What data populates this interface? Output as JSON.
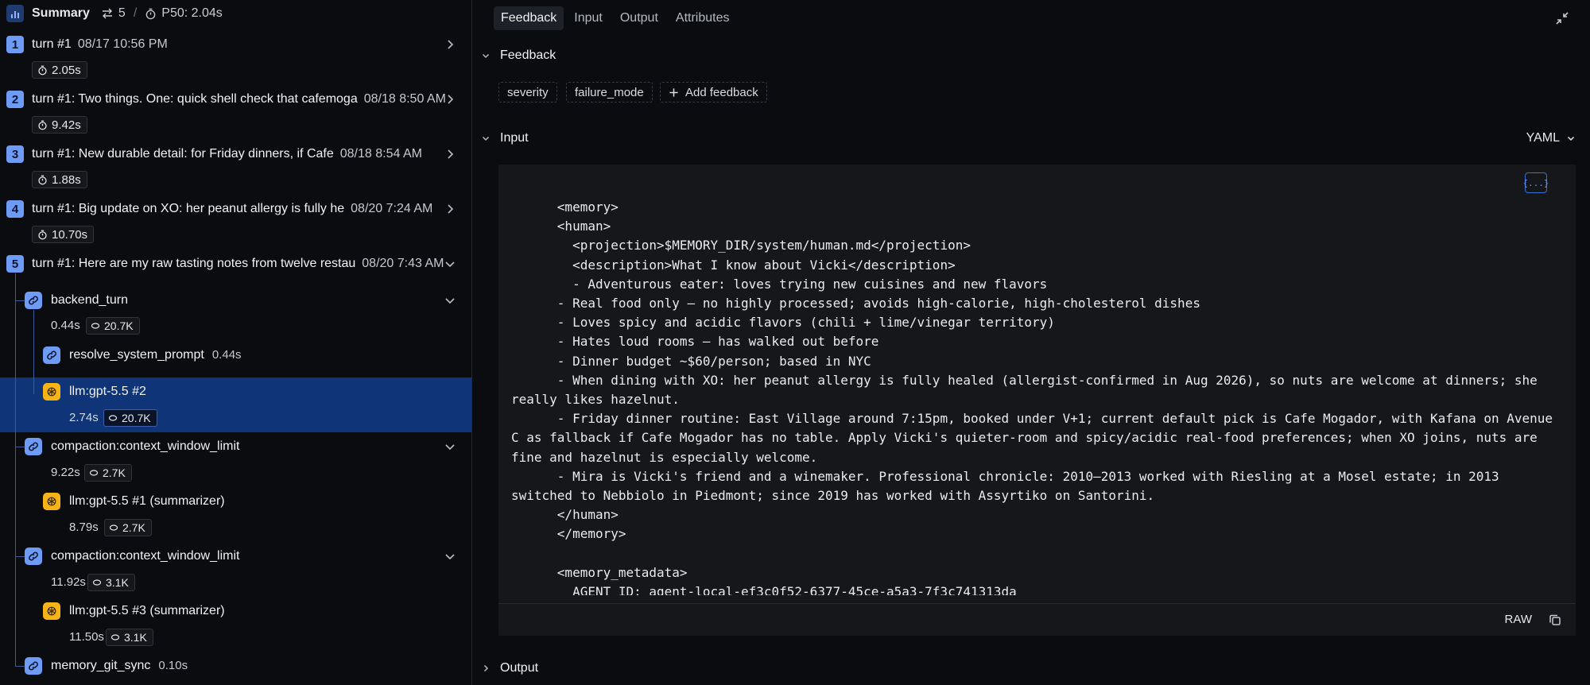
{
  "summary": {
    "title": "Summary",
    "turn_count": "5",
    "separator": "/",
    "p50": "P50: 2.04s"
  },
  "turns": [
    {
      "num": "1",
      "label": "turn #1",
      "date": "08/17 10:56 PM",
      "duration": "2.05s"
    },
    {
      "num": "2",
      "label": "turn #1: Two things. One: quick shell check that cafemoga",
      "date": "08/18 8:50 AM",
      "duration": "9.42s"
    },
    {
      "num": "3",
      "label": "turn #1: New durable detail: for Friday dinners, if Cafe",
      "date": "08/18 8:54 AM",
      "duration": "1.88s"
    },
    {
      "num": "4",
      "label": "turn #1: Big update on XO: her peanut allergy is fully he",
      "date": "08/20 7:24 AM",
      "duration": "10.70s"
    },
    {
      "num": "5",
      "label": "turn #1: Here are my raw tasting notes from twelve restau",
      "date": "08/20 7:43 AM"
    }
  ],
  "spans": {
    "backend_turn": {
      "label": "backend_turn",
      "duration": "0.44s",
      "tokens": "20.7K"
    },
    "resolve_system_prompt": {
      "label": "resolve_system_prompt",
      "duration": "0.44s"
    },
    "llm_2": {
      "label": "llm:gpt-5.5 #2",
      "duration": "2.74s",
      "tokens": "20.7K"
    },
    "compaction_1": {
      "label": "compaction:context_window_limit",
      "duration": "9.22s",
      "tokens": "2.7K"
    },
    "llm_1": {
      "label": "llm:gpt-5.5 #1 (summarizer)",
      "duration": "8.79s",
      "tokens": "2.7K"
    },
    "compaction_2": {
      "label": "compaction:context_window_limit",
      "duration": "11.92s",
      "tokens": "3.1K"
    },
    "llm_3": {
      "label": "llm:gpt-5.5 #3 (summarizer)",
      "duration": "11.50s",
      "tokens": "3.1K"
    },
    "memory_git_sync": {
      "label": "memory_git_sync",
      "duration": "0.10s"
    }
  },
  "tabs": [
    "Feedback",
    "Input",
    "Output",
    "Attributes"
  ],
  "feedback": {
    "heading": "Feedback",
    "chips": [
      "severity",
      "failure_mode"
    ],
    "add_label": "Add feedback"
  },
  "input": {
    "heading": "Input",
    "format": "YAML",
    "raw_label": "RAW",
    "code": "      <memory>\n      <human>\n        <projection>$MEMORY_DIR/system/human.md</projection>\n        <description>What I know about Vicki</description>\n        - Adventurous eater: loves trying new cuisines and new flavors\n      - Real food only — no highly processed; avoids high-calorie, high-cholesterol dishes\n      - Loves spicy and acidic flavors (chili + lime/vinegar territory)\n      - Hates loud rooms — has walked out before\n      - Dinner budget ~$60/person; based in NYC\n      - When dining with XO: her peanut allergy is fully healed (allergist-confirmed in Aug 2026), so nuts are welcome at dinners; she really likes hazelnut.\n      - Friday dinner routine: East Village around 7:15pm, booked under V+1; current default pick is Cafe Mogador, with Kafana on Avenue C as fallback if Cafe Mogador has no table. Apply Vicki's quieter-room and spicy/acidic real-food preferences; when XO joins, nuts are fine and hazelnut is especially welcome.\n      - Mira is Vicki's friend and a winemaker. Professional chronicle: 2010–2013 worked with Riesling at a Mosel estate; in 2013 switched to Nebbiolo in Piedmont; since 2019 has worked with Assyrtiko on Santorini.\n      </human>\n      </memory>\n\n      <memory_metadata>\n        AGENT_ID: agent-local-ef3c0f52-6377-45ce-a5a3-7f3c741313da"
  },
  "output": {
    "heading": "Output"
  }
}
